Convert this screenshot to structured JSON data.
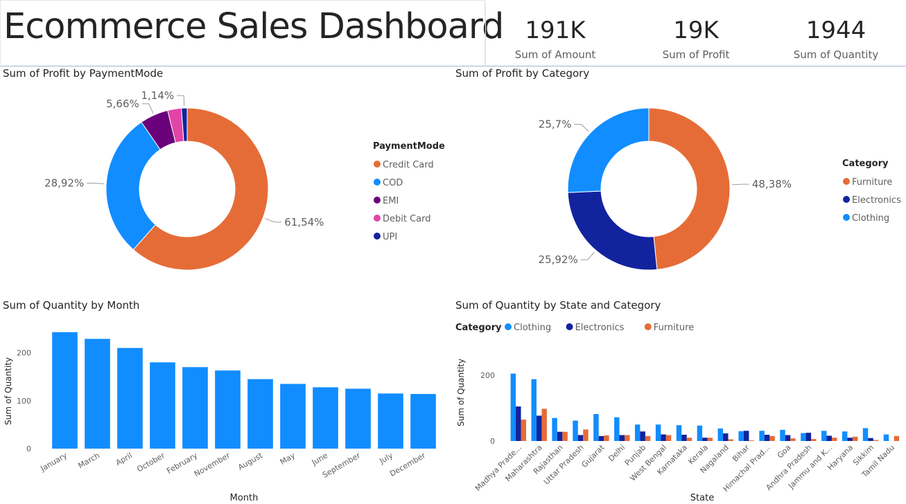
{
  "title": "Ecommerce Sales Dashboard",
  "kpis": [
    {
      "value": "191K",
      "label": "Sum of Amount"
    },
    {
      "value": "19K",
      "label": "Sum of Profit"
    },
    {
      "value": "1944",
      "label": "Sum of Quantity"
    }
  ],
  "colors": {
    "orange": "#E66C37",
    "blue": "#118DFF",
    "navy": "#12239E",
    "purple": "#6B007B",
    "pink": "#E044A7",
    "text": "#252423",
    "muted": "#605e5c"
  },
  "chart_data": [
    {
      "type": "pie",
      "title": "Sum of Profit by PaymentMode",
      "legend_title": "PaymentMode",
      "legend": "right",
      "slices": [
        {
          "label": "Credit Card",
          "value": 61.54,
          "display": "61,54%",
          "color": "#E66C37"
        },
        {
          "label": "COD",
          "value": 28.92,
          "display": "28,92%",
          "color": "#118DFF"
        },
        {
          "label": "EMI",
          "value": 5.66,
          "display": "5,66%",
          "color": "#6B007B"
        },
        {
          "label": "Debit Card",
          "value": 2.74,
          "display": "",
          "color": "#E044A7"
        },
        {
          "label": "UPI",
          "value": 1.14,
          "display": "1,14%",
          "color": "#12239E"
        }
      ]
    },
    {
      "type": "pie",
      "title": "Sum of Profit by Category",
      "legend_title": "Category",
      "legend": "right",
      "slices": [
        {
          "label": "Furniture",
          "value": 48.38,
          "display": "48,38%",
          "color": "#E66C37"
        },
        {
          "label": "Electronics",
          "value": 25.92,
          "display": "25,92%",
          "color": "#12239E"
        },
        {
          "label": "Clothing",
          "value": 25.7,
          "display": "25,7%",
          "color": "#118DFF"
        }
      ]
    },
    {
      "type": "bar",
      "title": "Sum of Quantity by Month",
      "xlabel": "Month",
      "ylabel": "Sum of Quantity",
      "ylim": [
        0,
        260
      ],
      "yticks": [
        0,
        100,
        200
      ],
      "categories": [
        "January",
        "March",
        "April",
        "October",
        "February",
        "November",
        "August",
        "May",
        "June",
        "September",
        "July",
        "December"
      ],
      "values": [
        243,
        229,
        210,
        180,
        170,
        163,
        145,
        135,
        128,
        125,
        115,
        114
      ],
      "color": "#118DFF"
    },
    {
      "type": "bar",
      "title": "Sum of Quantity by State and Category",
      "xlabel": "State",
      "ylabel": "Sum of Quantity",
      "legend_title": "Category",
      "legend": "top-left",
      "ylim": [
        0,
        230
      ],
      "yticks": [
        0,
        200
      ],
      "categories": [
        "Madhya Prade...",
        "Maharashtra",
        "Rajasthan",
        "Uttar Pradesh",
        "Gujarat",
        "Delhi",
        "Punjab",
        "West Bengal",
        "Karnataka",
        "Kerala",
        "Nagaland",
        "Bihar",
        "Himachal Prad...",
        "Goa",
        "Andhra Pradesh",
        "Jammu and K...",
        "Haryana",
        "Sikkim",
        "Tamil Nadu"
      ],
      "series": [
        {
          "name": "Clothing",
          "color": "#118DFF",
          "values": [
            205,
            188,
            70,
            62,
            82,
            72,
            50,
            50,
            48,
            47,
            38,
            30,
            31,
            34,
            24,
            31,
            29,
            39,
            20
          ]
        },
        {
          "name": "Electronics",
          "color": "#12239E",
          "values": [
            105,
            77,
            28,
            18,
            15,
            18,
            29,
            20,
            19,
            10,
            23,
            31,
            19,
            18,
            25,
            16,
            10,
            9,
            0
          ]
        },
        {
          "name": "Furniture",
          "color": "#E66C37",
          "values": [
            65,
            98,
            28,
            35,
            17,
            18,
            15,
            18,
            10,
            10,
            5,
            2,
            15,
            8,
            6,
            10,
            13,
            3,
            15
          ]
        }
      ]
    }
  ]
}
